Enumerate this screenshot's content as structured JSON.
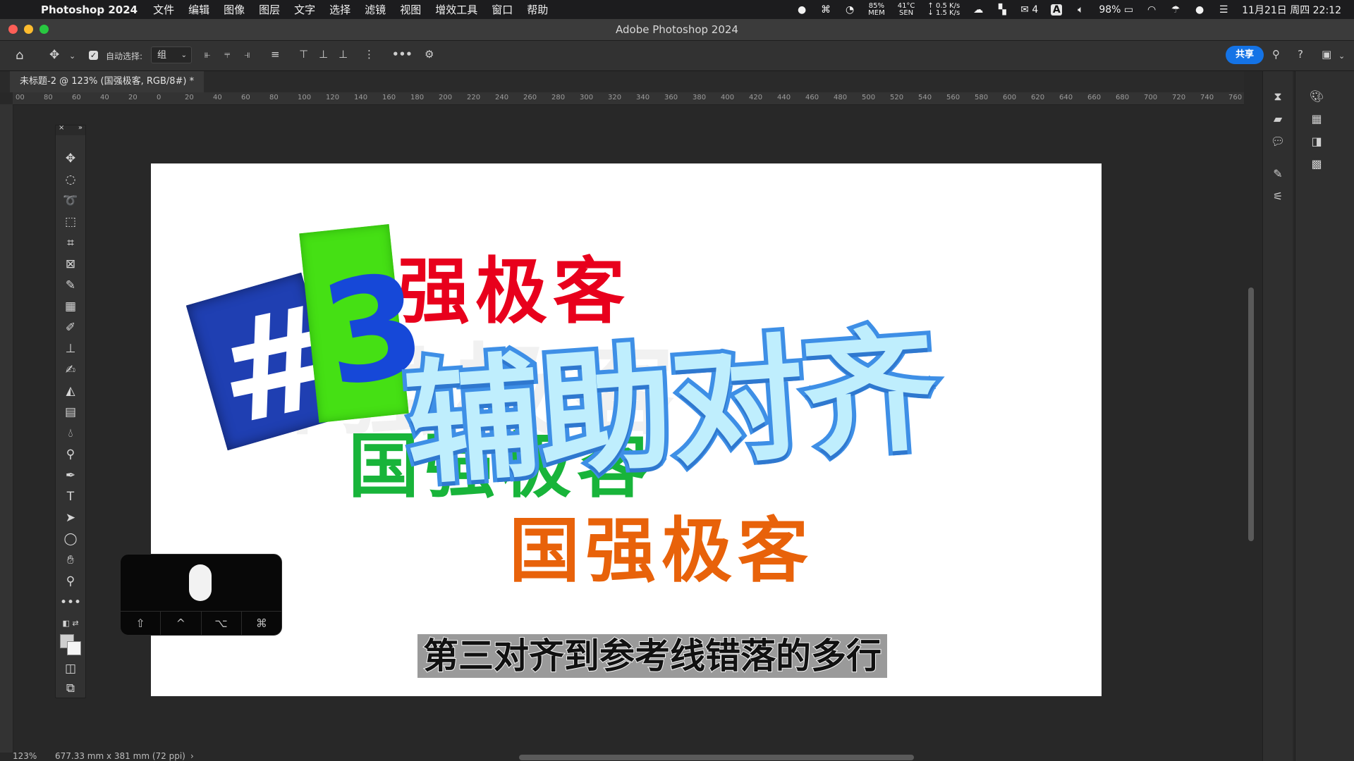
{
  "menubar": {
    "app_name": "Photoshop 2024",
    "items": [
      "文件",
      "编辑",
      "图像",
      "图层",
      "文字",
      "选择",
      "滤镜",
      "视图",
      "增效工具",
      "窗口",
      "帮助"
    ],
    "mem": "85%",
    "mem_label": "MEM",
    "temp": "41°C",
    "temp_label": "SEN",
    "net_up": "↑ 0.5 K/s",
    "net_down": "↓ 1.5 K/s",
    "wechat_count": "4",
    "battery": "98%",
    "datetime": "11月21日 周四 22:12"
  },
  "window": {
    "title": "Adobe Photoshop 2024"
  },
  "options": {
    "auto_select_label": "自动选择:",
    "auto_select_value": "组",
    "share_label": "共享"
  },
  "document": {
    "tab_title": "未标题-2 @ 123% (国强极客, RGB/8#) *",
    "zoom": "123%",
    "dimensions": "677.33 mm x 381 mm (72 ppi)"
  },
  "ruler": {
    "top_ticks": [
      "00",
      "80",
      "60",
      "40",
      "20",
      "0",
      "20",
      "40",
      "60",
      "80",
      "100",
      "120",
      "140",
      "160",
      "180",
      "200",
      "220",
      "240",
      "260",
      "280",
      "300",
      "320",
      "340",
      "360",
      "380",
      "400",
      "420",
      "440",
      "460",
      "480",
      "500",
      "520",
      "540",
      "560",
      "580",
      "600",
      "620",
      "640",
      "660",
      "680",
      "700",
      "720",
      "740",
      "760"
    ]
  },
  "canvas": {
    "ghost_text": "国强极客",
    "red_text": "强极客",
    "green_text": "国强极客",
    "orange_text": "国强极客",
    "hash_text": "#",
    "number_text": "3",
    "big_title": "辅助对齐",
    "subtitle": "第三对齐到参考线错落的多行",
    "colors": {
      "red": "#e8001c",
      "green": "#18b43a",
      "orange": "#e8620a",
      "blue_block": "#1f3fb2",
      "green_block": "#45e014",
      "title_fill": "#bfeefd",
      "title_stroke": "#3e8fe6"
    }
  },
  "keyboard_overlay": {
    "keys": [
      "⇧",
      "^",
      "⌥",
      "⌘"
    ]
  },
  "tools": [
    "move-tool",
    "marquee-tool",
    "lasso-tool",
    "object-select-tool",
    "crop-tool",
    "frame-tool",
    "eyedropper-tool",
    "spot-heal-tool",
    "brush-tool",
    "stamp-tool",
    "history-brush-tool",
    "eraser-tool",
    "gradient-tool",
    "blur-tool",
    "dodge-tool",
    "pen-tool",
    "type-tool",
    "path-select-tool",
    "ellipse-tool",
    "hand-tool",
    "zoom-tool",
    "more-tools"
  ]
}
